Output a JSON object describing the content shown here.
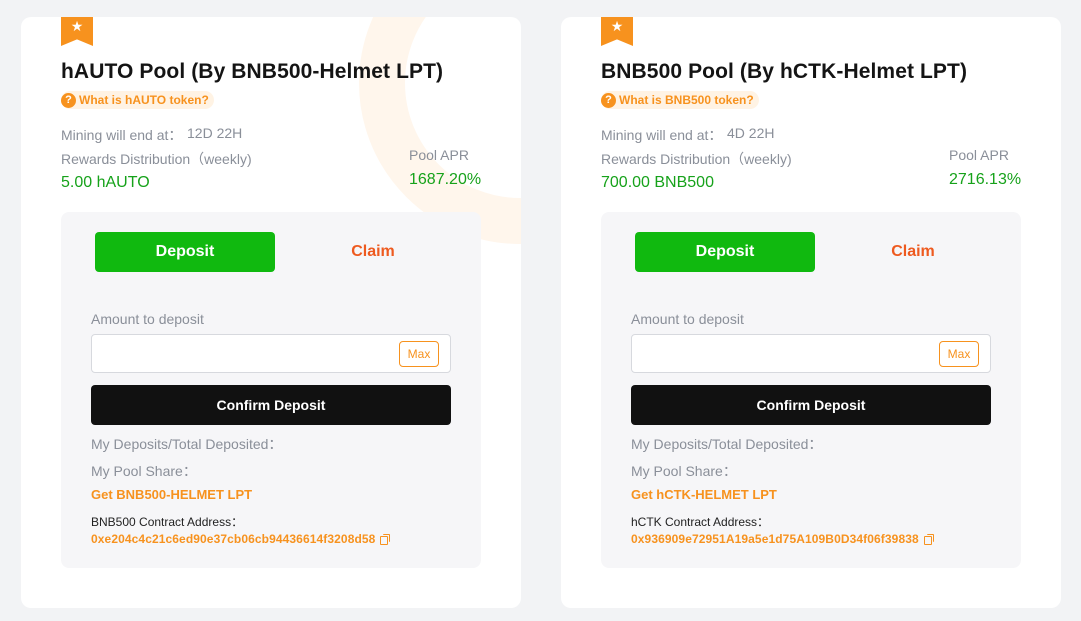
{
  "pools": [
    {
      "title": "hAUTO Pool (By BNB500-Helmet LPT)",
      "help_link": "What is hAUTO token?",
      "mining_end_label": "Mining will end at：",
      "mining_end_value": "12D 22H",
      "rewards_label": "Rewards Distribution（weekly)",
      "rewards_value": "5.00 hAUTO",
      "apr_label": "Pool APR",
      "apr_value": "1687.20%",
      "tab_deposit": "Deposit",
      "tab_claim": "Claim",
      "amount_label": "Amount to deposit",
      "amount_value": "",
      "amount_placeholder": "",
      "max_label": "Max",
      "confirm_label": "Confirm Deposit",
      "my_deposits_label": "My Deposits/Total Deposited：",
      "my_share_label": "My Pool Share：",
      "get_lpt_link": "Get BNB500-HELMET LPT",
      "contract_label": "BNB500 Contract Address：",
      "contract_address": "0xe204c4c21c6ed90e37cb06cb94436614f3208d58"
    },
    {
      "title": "BNB500 Pool (By hCTK-Helmet LPT)",
      "help_link": "What is BNB500 token?",
      "mining_end_label": "Mining will end at：",
      "mining_end_value": "4D 22H",
      "rewards_label": "Rewards Distribution（weekly)",
      "rewards_value": "700.00 BNB500",
      "apr_label": "Pool APR",
      "apr_value": "2716.13%",
      "tab_deposit": "Deposit",
      "tab_claim": "Claim",
      "amount_label": "Amount to deposit",
      "amount_value": "",
      "amount_placeholder": "",
      "max_label": "Max",
      "confirm_label": "Confirm Deposit",
      "my_deposits_label": "My Deposits/Total Deposited：",
      "my_share_label": "My Pool Share：",
      "get_lpt_link": "Get hCTK-HELMET LPT",
      "contract_label": "hCTK Contract Address：",
      "contract_address": "0x936909e72951A19a5e1d75A109B0D34f06f39838"
    }
  ],
  "colors": {
    "accent_orange": "#f7921e",
    "claim_orange": "#ee5a1f",
    "deposit_green": "#10b90f",
    "value_green": "#16a21a",
    "confirm_black": "#111111"
  },
  "icons": {
    "ribbon": "star-ribbon-icon",
    "help": "question-circle-icon",
    "copy": "copy-icon"
  }
}
